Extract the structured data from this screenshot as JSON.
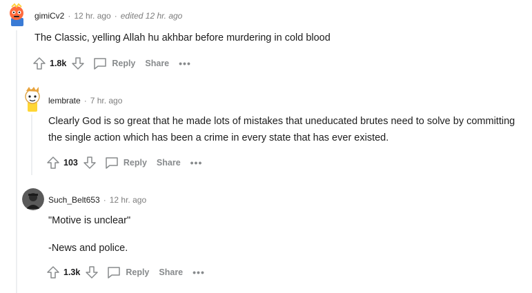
{
  "comments": [
    {
      "author": "gimiCv2",
      "sep": "·",
      "time": "12 hr. ago",
      "edited_sep": "·",
      "edited": "edited 12 hr. ago",
      "avatar_icon": "snoo-avatar-icon",
      "body": [
        "The Classic, yelling Allah hu akhbar before murdering in cold blood"
      ],
      "votes": "1.8k",
      "reply": "Reply",
      "share": "Share",
      "more": "•••"
    },
    {
      "author": "lembrate",
      "sep": "·",
      "time": "7 hr. ago",
      "avatar_icon": "snoo-avatar-icon",
      "body": [
        "Clearly God is so great that he made lots of mistakes that uneducated brutes need to solve by committing the single action which has been a crime in every state that has ever existed."
      ],
      "votes": "103",
      "reply": "Reply",
      "share": "Share",
      "more": "•••"
    },
    {
      "author": "Such_Belt653",
      "sep": "·",
      "time": "12 hr. ago",
      "avatar_icon": "photo-avatar-icon",
      "body": [
        "\"Motive is unclear\"",
        "-News and police."
      ],
      "votes": "1.3k",
      "reply": "Reply",
      "share": "Share",
      "more": "•••"
    }
  ],
  "colors": {
    "text": "#1c1c1c",
    "meta": "#7c7c7c",
    "action": "#878a8c",
    "thread": "#edeff1"
  }
}
